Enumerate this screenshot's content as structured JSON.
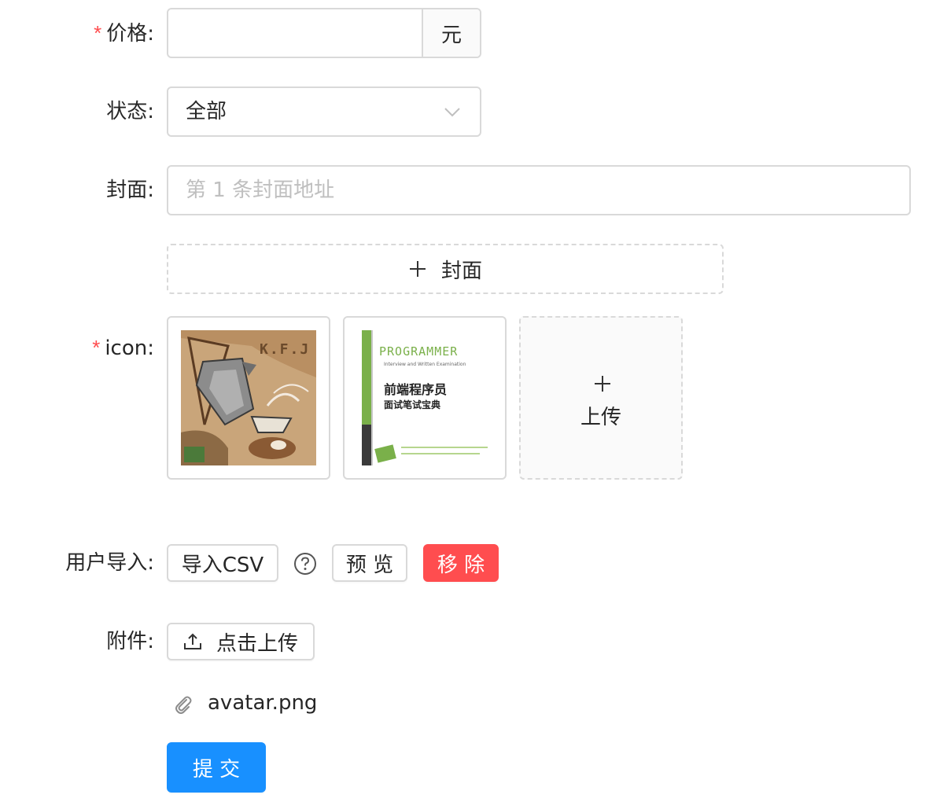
{
  "form": {
    "price": {
      "label": "价格",
      "colon": ":",
      "value": "",
      "suffix": "元"
    },
    "status": {
      "label": "状态",
      "colon": ":",
      "selected": "全部"
    },
    "cover": {
      "label": "封面",
      "colon": ":",
      "placeholder": "第 1 条封面地址",
      "add_button": "封面"
    },
    "icon": {
      "label": "icon",
      "colon": ":",
      "images": [
        {
          "name": "coffee-image",
          "text": "K.F.J"
        },
        {
          "name": "book-cover-image",
          "title_en": "PROGRAMMER",
          "sub_en": "Interview and Written Examination",
          "title_cn": "前端程序员",
          "sub_cn": "面试笔试宝典"
        }
      ],
      "upload_label": "上传"
    },
    "user_import": {
      "label": "用户导入",
      "colon": ":",
      "import_button": "导入CSV",
      "preview_button": "预 览",
      "remove_button": "移 除"
    },
    "attachment": {
      "label": "附件",
      "colon": ":",
      "upload_button": "点击上传",
      "files": [
        "avatar.png"
      ]
    },
    "submit_button": "提 交"
  },
  "colors": {
    "required": "#ff4d4f",
    "danger": "#ff4d4f",
    "primary": "#1890ff",
    "border": "#d9d9d9"
  }
}
